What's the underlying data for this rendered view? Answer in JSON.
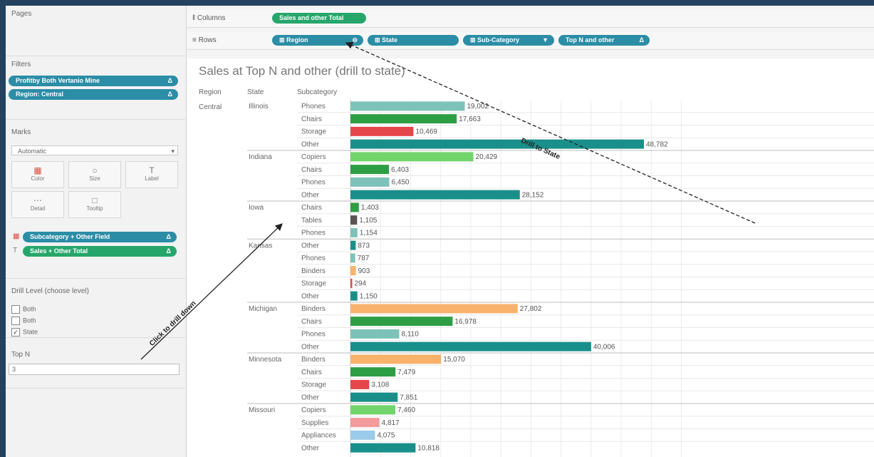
{
  "pages": {
    "title": "Pages"
  },
  "filters": {
    "title": "Filters",
    "pills": [
      {
        "label": "Profitby Both Vertanio Mine",
        "suffix": "Δ"
      },
      {
        "label": "Region: Central",
        "suffix": "Δ"
      }
    ]
  },
  "marks": {
    "title": "Marks",
    "type": "Automatic",
    "buttons": [
      "Color",
      "Size",
      "Label",
      "Detail",
      "Tooltip"
    ],
    "fields": [
      {
        "label": "Subcategory + Other Field",
        "suffix": "Δ",
        "color": "teal"
      },
      {
        "label": "Sales + Other Total",
        "suffix": "Δ",
        "color": "green"
      }
    ]
  },
  "level_param": {
    "title": "Drill Level (choose level)",
    "options": [
      {
        "label": "Both",
        "checked": false
      },
      {
        "label": "Both",
        "checked": false
      },
      {
        "label": "State",
        "checked": true
      }
    ]
  },
  "topn": {
    "title": "Top N",
    "value": "3"
  },
  "shelves": {
    "columns_label": "Columns",
    "rows_label": "Rows",
    "column_pills": [
      {
        "label": "Sales and other Total"
      }
    ],
    "row_pills": [
      {
        "label": "Region",
        "suffix": "⊖"
      },
      {
        "label": "State",
        "suffix": ""
      },
      {
        "label": "Sub-Category",
        "suffix": "▼"
      },
      {
        "label": "Top N and other",
        "suffix": "Δ"
      }
    ]
  },
  "view": {
    "title": "Sales at Top N and other (drill to state)",
    "headers": {
      "region": "Region",
      "state": "State",
      "subcategory": "Subcategory"
    }
  },
  "annotations": {
    "drill": "Drill to State",
    "click": "Click to drill down"
  },
  "colors": {
    "teal": "#2b8da6",
    "green_pill": "#26a66b",
    "Phones": "#7dc2b8",
    "Chairs": "#2e9e44",
    "Storage": "#e5464b",
    "Other": "#1a8f8a",
    "Copiers": "#72d56b",
    "Tables": "#5b5453",
    "Binders": "#f9b26c",
    "Supplies": "#f39a9c",
    "Appliances": "#9ccbea"
  },
  "chart_data": {
    "type": "bar",
    "xlim": [
      0,
      55000
    ],
    "region": "Central",
    "rows": [
      {
        "state": "Illinois",
        "subcategory": "Phones",
        "value": 19002,
        "label": "19,002"
      },
      {
        "state": "",
        "subcategory": "Chairs",
        "value": 17663,
        "label": "17,663"
      },
      {
        "state": "",
        "subcategory": "Storage",
        "value": 10469,
        "label": "10,469"
      },
      {
        "state": "",
        "subcategory": "Other",
        "value": 48782,
        "label": "48,782"
      },
      {
        "state": "Indiana",
        "subcategory": "Copiers",
        "value": 20429,
        "label": "20,429"
      },
      {
        "state": "",
        "subcategory": "Chairs",
        "value": 6403,
        "label": "6,403"
      },
      {
        "state": "",
        "subcategory": "Phones",
        "value": 6450,
        "label": "6,450"
      },
      {
        "state": "",
        "subcategory": "Other",
        "value": 28152,
        "label": "28,152"
      },
      {
        "state": "Iowa",
        "subcategory": "Chairs",
        "value": 1403,
        "label": "1,403"
      },
      {
        "state": "",
        "subcategory": "Tables",
        "value": 1105,
        "label": "1,105"
      },
      {
        "state": "",
        "subcategory": "Phones",
        "value": 1154,
        "label": "1,154"
      },
      {
        "state": "Kansas",
        "subcategory": "Other",
        "value": 873,
        "label": "873"
      },
      {
        "state": "",
        "subcategory": "Phones",
        "value": 787,
        "label": "787"
      },
      {
        "state": "",
        "subcategory": "Binders",
        "value": 903,
        "label": "903"
      },
      {
        "state": "",
        "subcategory": "Storage",
        "value": 294,
        "label": "294"
      },
      {
        "state": "",
        "subcategory": "Other",
        "value": 1150,
        "label": "1,150"
      },
      {
        "state": "Michigan",
        "subcategory": "Binders",
        "value": 27802,
        "label": "27,802"
      },
      {
        "state": "",
        "subcategory": "Chairs",
        "value": 16978,
        "label": "16,978"
      },
      {
        "state": "",
        "subcategory": "Phones",
        "value": 8110,
        "label": "8,110"
      },
      {
        "state": "",
        "subcategory": "Other",
        "value": 40006,
        "label": "40,006"
      },
      {
        "state": "Minnesota",
        "subcategory": "Binders",
        "value": 15070,
        "label": "15,070"
      },
      {
        "state": "",
        "subcategory": "Chairs",
        "value": 7479,
        "label": "7,479"
      },
      {
        "state": "",
        "subcategory": "Storage",
        "value": 3108,
        "label": "3,108"
      },
      {
        "state": "",
        "subcategory": "Other",
        "value": 7851,
        "label": "7,851"
      },
      {
        "state": "Missouri",
        "subcategory": "Copiers",
        "value": 7460,
        "label": "7,460"
      },
      {
        "state": "",
        "subcategory": "Supplies",
        "value": 4817,
        "label": "4,817"
      },
      {
        "state": "",
        "subcategory": "Appliances",
        "value": 4075,
        "label": "4,075"
      },
      {
        "state": "",
        "subcategory": "Other",
        "value": 10818,
        "label": "10,818"
      }
    ]
  }
}
